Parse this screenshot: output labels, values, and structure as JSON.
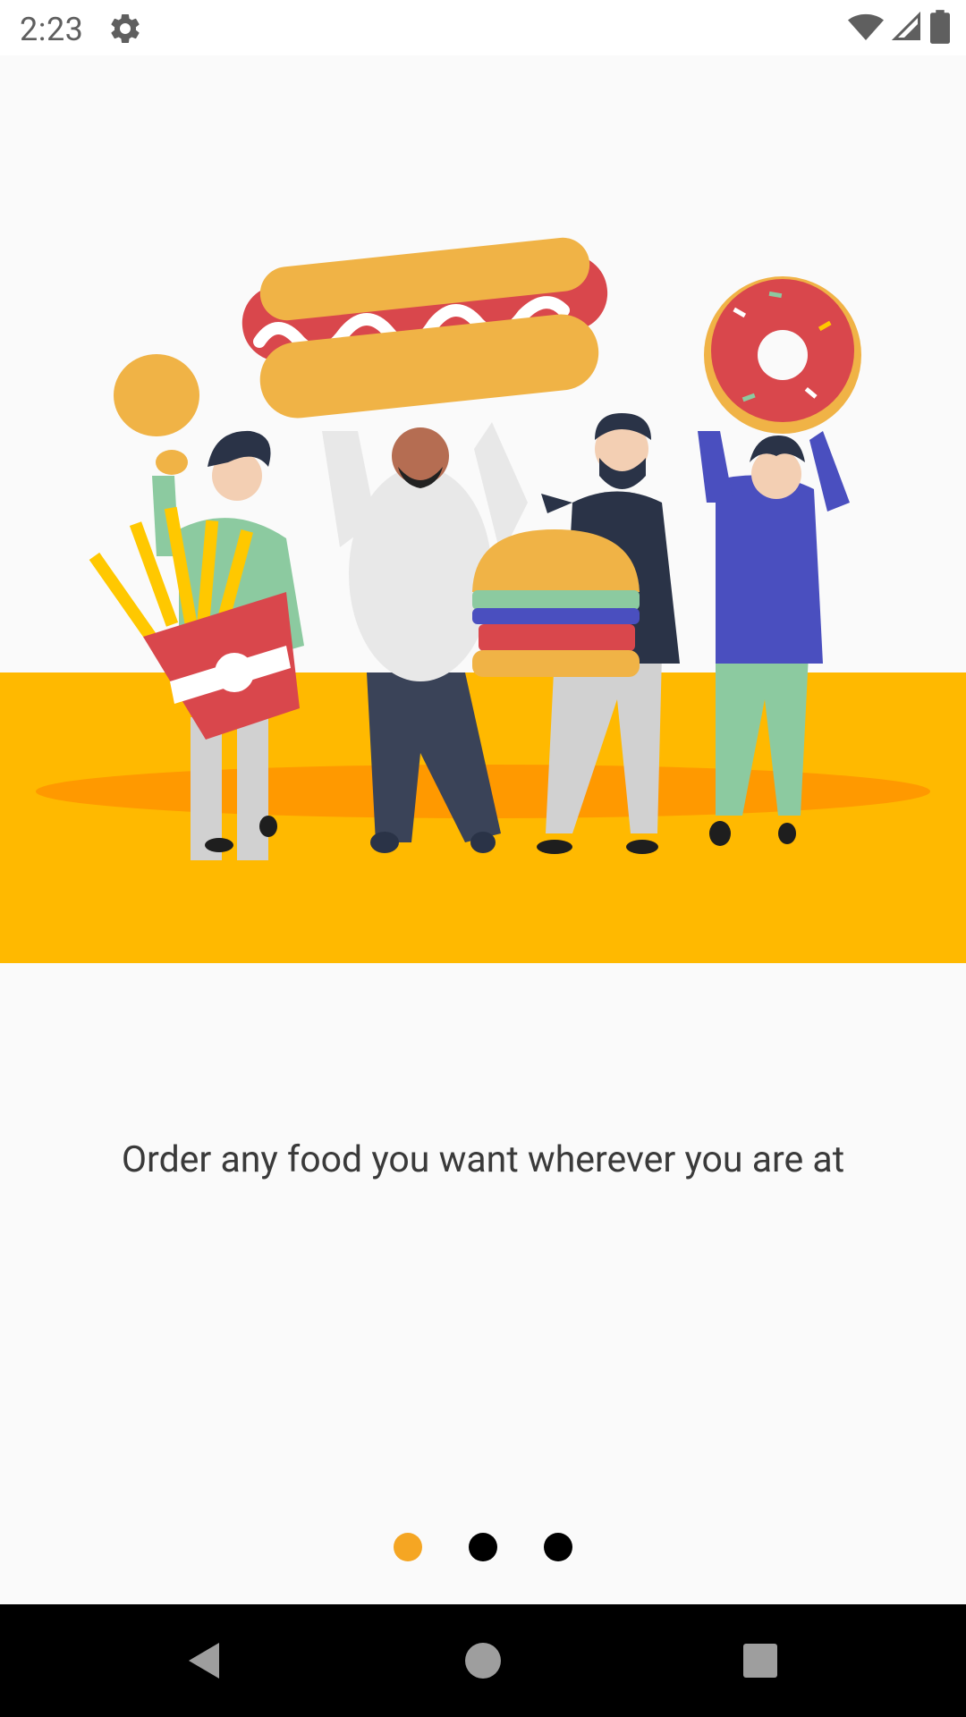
{
  "status": {
    "time": "2:23",
    "icons": [
      "settings-gear-icon",
      "wifi-icon",
      "cell-signal-icon",
      "battery-icon"
    ]
  },
  "illustration": {
    "name": "people-holding-food-illustration",
    "band_color": "#ffb900"
  },
  "caption": "Order any food you want wherever you are at",
  "pager": {
    "total": 3,
    "active_index": 0,
    "active_color": "#f5a623",
    "inactive_color": "#000000"
  },
  "nav": {
    "buttons": [
      "back-icon",
      "home-icon",
      "recents-icon"
    ]
  }
}
